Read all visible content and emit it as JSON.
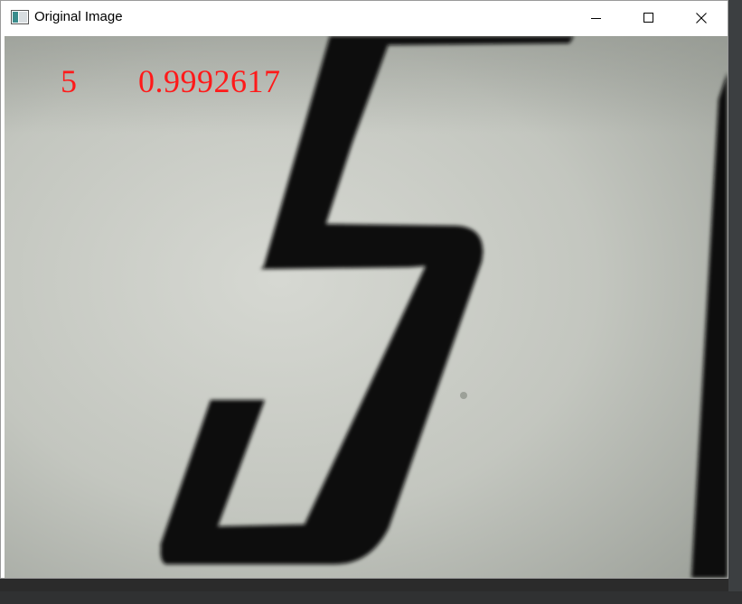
{
  "window": {
    "title": "Original Image",
    "controls": {
      "minimize_icon": "minimize-icon",
      "maximize_icon": "maximize-icon",
      "close_icon": "close-icon"
    }
  },
  "overlay": {
    "label": "5",
    "score": "0.9992617",
    "color": "#ff1a1a"
  },
  "image": {
    "subject": "digit-5-photo",
    "background_color": "#c7cac2",
    "ink_color": "#0a0a0a"
  }
}
